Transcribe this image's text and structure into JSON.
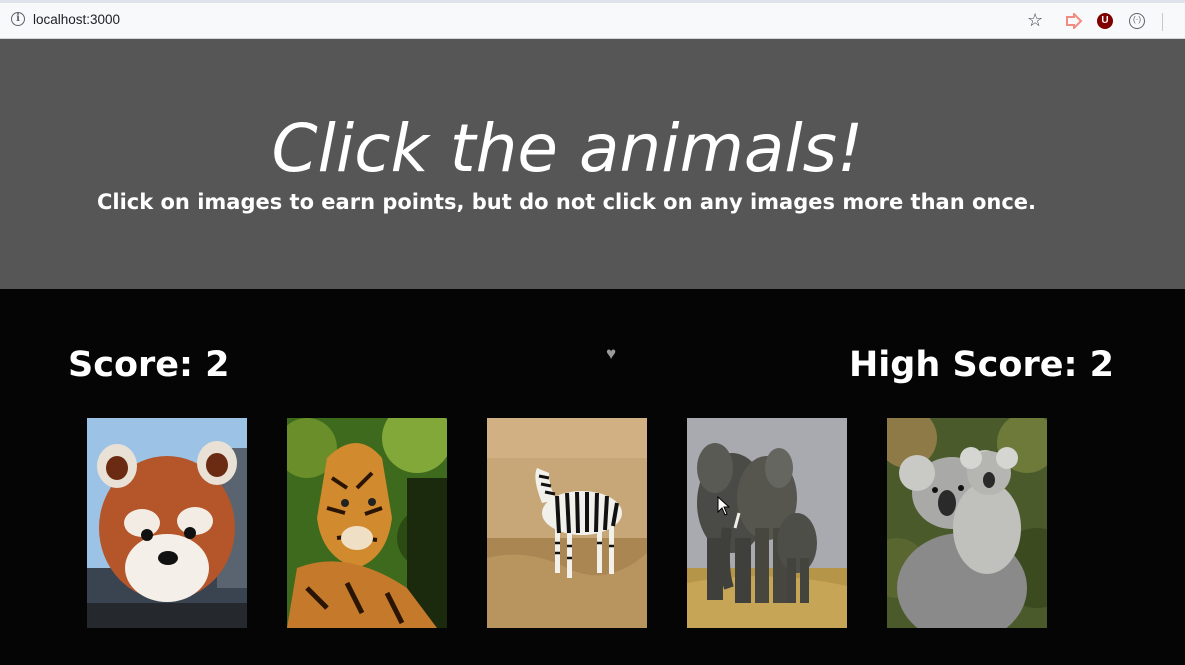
{
  "browser": {
    "url": "localhost:3000",
    "icons": [
      "info-icon",
      "star-icon",
      "extension-arrow-icon",
      "ublock-icon",
      "extension-icon"
    ]
  },
  "header": {
    "title": "Click the animals!",
    "subtitle": "Click on images to earn points, but do not click on any images more than once."
  },
  "scoreboard": {
    "score": "Score: 2",
    "high_score": "High Score: 2",
    "icon": "heart-icon"
  },
  "cards": [
    {
      "name": "red-panda"
    },
    {
      "name": "tiger"
    },
    {
      "name": "zebra"
    },
    {
      "name": "elephants"
    },
    {
      "name": "koala"
    }
  ],
  "colors": {
    "header_bg": "#565656",
    "page_bg": "#050505",
    "text": "#ffffff"
  }
}
